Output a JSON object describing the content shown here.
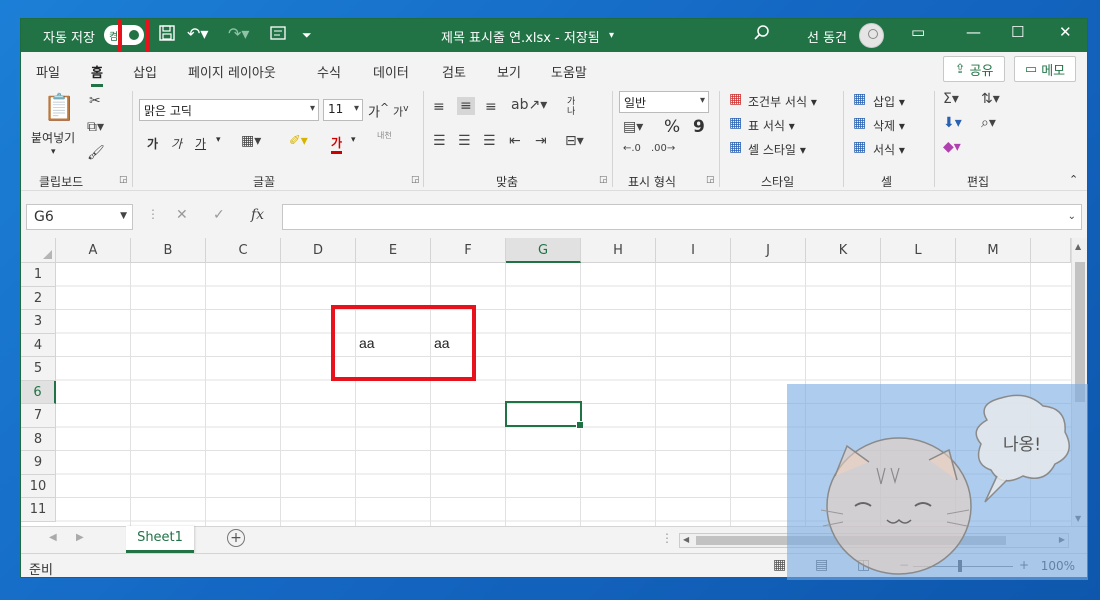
{
  "titlebar": {
    "autosave_label": "자동 저장",
    "toggle_state": "켬",
    "doc_title": "제목 표시줄 연.xlsx - 저장됨",
    "user_name": "선 동건",
    "icons": [
      "save-icon",
      "undo-icon",
      "redo-icon",
      "form-icon",
      "customize-icon",
      "search-icon",
      "ribbon-display-icon",
      "minimize-icon",
      "maximize-icon",
      "close-icon"
    ]
  },
  "tabs": [
    "파일",
    "홈",
    "삽입",
    "페이지 레이아웃",
    "수식",
    "데이터",
    "검토",
    "보기",
    "도움말"
  ],
  "active_tab": "홈",
  "share_label": "공유",
  "memo_label": "메모",
  "ribbon": {
    "clipboard": {
      "paste": "붙여넣기",
      "label": "클립보드"
    },
    "font": {
      "name": "맑은 고딕",
      "size": "11",
      "bold": "가",
      "italic": "가",
      "underline": "가",
      "font_color_glyph": "가",
      "phonetic": "내천",
      "grow": "가",
      "shrink": "가",
      "label": "글꼴"
    },
    "alignment": {
      "wrap": "가나",
      "label": "맞춤"
    },
    "number": {
      "format": "일반",
      "percent": "%",
      "comma": "9",
      "label": "표시 형식"
    },
    "styles": {
      "conditional": "조건부 서식",
      "table": "표 서식",
      "cell": "셀 스타일",
      "label": "스타일"
    },
    "cells": {
      "insert": "삽입",
      "delete": "삭제",
      "format": "서식",
      "label": "셀"
    },
    "editing": {
      "label": "편집"
    }
  },
  "formula_bar": {
    "name_box": "G6",
    "cancel": "✕",
    "enter": "✓",
    "fx": "fx",
    "value": ""
  },
  "columns": [
    "A",
    "B",
    "C",
    "D",
    "E",
    "F",
    "G",
    "H",
    "I",
    "J",
    "K",
    "L",
    "M"
  ],
  "rows": [
    "1",
    "2",
    "3",
    "4",
    "5",
    "6",
    "7",
    "8",
    "9",
    "10",
    "11"
  ],
  "selected_cell": "G6",
  "cell_values": {
    "E3": "aa",
    "F3": "aa"
  },
  "sheet": {
    "name": "Sheet1"
  },
  "status": {
    "ready": "준비",
    "zoom": "100%"
  },
  "watermark_text": "나옹!"
}
